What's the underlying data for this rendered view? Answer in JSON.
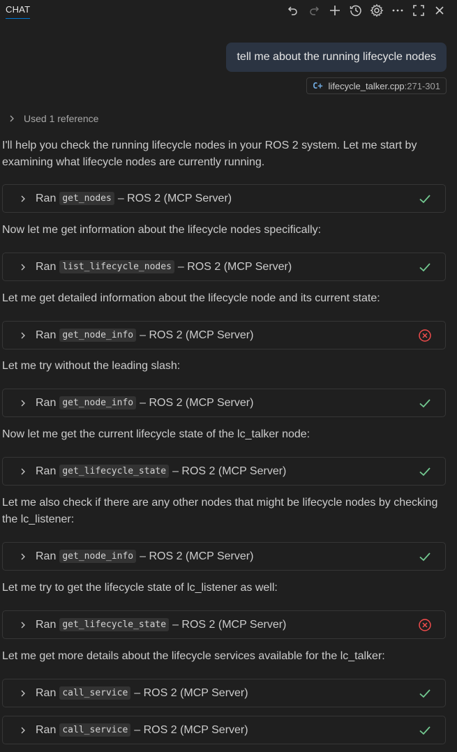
{
  "header": {
    "tab_label": "CHAT",
    "toolbar": [
      "undo-icon",
      "redo-icon",
      "plus-icon",
      "history-icon",
      "gear-icon",
      "more-icon",
      "maximize-icon",
      "close-icon"
    ]
  },
  "user_message": {
    "text": "tell me about the running lifecycle nodes",
    "attachment": {
      "filename": "lifecycle_talker.cpp",
      "range": ":271-301"
    }
  },
  "used_reference": "Used 1 reference",
  "paragraphs": [
    "I'll help you check the running lifecycle nodes in your ROS 2 system. Let me start by examining what lifecycle nodes are currently running.",
    "Now let me get information about the lifecycle nodes specifically:",
    "Let me get detailed information about the lifecycle node and its current state:",
    "Let me try without the leading slash:",
    "Now let me get the current lifecycle state of the lc_talker node:",
    "Let me also check if there are any other nodes that might be lifecycle nodes by checking the lc_listener:",
    "Let me try to get the lifecycle state of lc_listener as well:",
    "Let me get more details about the lifecycle services available for the lc_talker:"
  ],
  "tool_calls": [
    {
      "ran": "Ran",
      "tool": "get_nodes",
      "server": "– ROS 2 (MCP Server)",
      "status": "success"
    },
    {
      "ran": "Ran",
      "tool": "list_lifecycle_nodes",
      "server": "– ROS 2 (MCP Server)",
      "status": "success"
    },
    {
      "ran": "Ran",
      "tool": "get_node_info",
      "server": "– ROS 2 (MCP Server)",
      "status": "error"
    },
    {
      "ran": "Ran",
      "tool": "get_node_info",
      "server": "– ROS 2 (MCP Server)",
      "status": "success"
    },
    {
      "ran": "Ran",
      "tool": "get_lifecycle_state",
      "server": "– ROS 2 (MCP Server)",
      "status": "success"
    },
    {
      "ran": "Ran",
      "tool": "get_node_info",
      "server": "– ROS 2 (MCP Server)",
      "status": "success"
    },
    {
      "ran": "Ran",
      "tool": "get_lifecycle_state",
      "server": "– ROS 2 (MCP Server)",
      "status": "error"
    },
    {
      "ran": "Ran",
      "tool": "call_service",
      "server": "– ROS 2 (MCP Server)",
      "status": "success"
    },
    {
      "ran": "Ran",
      "tool": "call_service",
      "server": "– ROS 2 (MCP Server)",
      "status": "success"
    }
  ],
  "colors": {
    "background": "#1f1f1f",
    "success": "#73c991",
    "error": "#f14c4c",
    "accent": "#0078d4"
  }
}
